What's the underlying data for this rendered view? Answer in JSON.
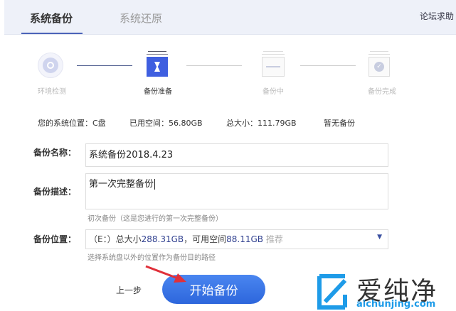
{
  "tabs": [
    {
      "label": "系统备份",
      "active": true
    },
    {
      "label": "系统还原",
      "active": false
    }
  ],
  "help_link": "论坛求助",
  "steps": [
    {
      "label": "环境检测",
      "icon": "search-icon"
    },
    {
      "label": "备份准备",
      "icon": "hourglass-icon",
      "active": true
    },
    {
      "label": "备份中",
      "icon": "progress-icon"
    },
    {
      "label": "备份完成",
      "icon": "check-icon"
    }
  ],
  "info": {
    "system_location": "您的系统位置：C盘",
    "used_space": "已用空间：56.80GB",
    "total_size": "总大小：111.79GB",
    "backup_status": "暂无备份"
  },
  "form": {
    "name_label": "备份名称：",
    "name_value": "系统备份2018.4.23",
    "desc_label": "备份描述：",
    "desc_value": "第一次完整备份",
    "desc_hint": "初次备份（这是您进行的第一次完整备份）",
    "location_label": "备份位置：",
    "location_prefix": "（E：）总大小",
    "location_total": "288.31GB",
    "location_mid": "，可用空间",
    "location_free": "88.11GB",
    "location_tag": "推荐",
    "location_hint": "选择系统盘以外的位置作为备份目的路径"
  },
  "buttons": {
    "prev": "上一步",
    "start": "开始备份"
  },
  "watermark": {
    "brand": "爱纯净",
    "domain": "aichunjing.com"
  },
  "colors": {
    "accent": "#3f5fe0",
    "button": "#3b73e8",
    "arrow": "#e0303a"
  }
}
